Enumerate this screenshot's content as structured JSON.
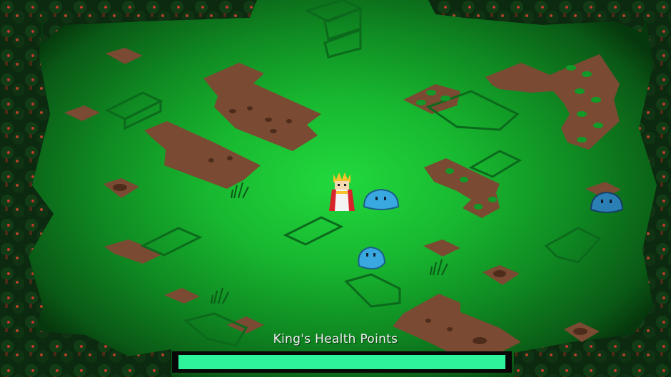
{
  "hud": {
    "health_label": "King's Health Points",
    "health_fraction": 1.0,
    "health_color": "#2ef39a"
  },
  "entities": {
    "king": "king-character",
    "slimes": [
      "slime-enemy",
      "slime-enemy",
      "slime-enemy"
    ]
  },
  "colors": {
    "grass_center": "#21d93e",
    "dirt": "#7a4a32",
    "slime": "#3aa8e0",
    "tree": "#0c2a10"
  }
}
